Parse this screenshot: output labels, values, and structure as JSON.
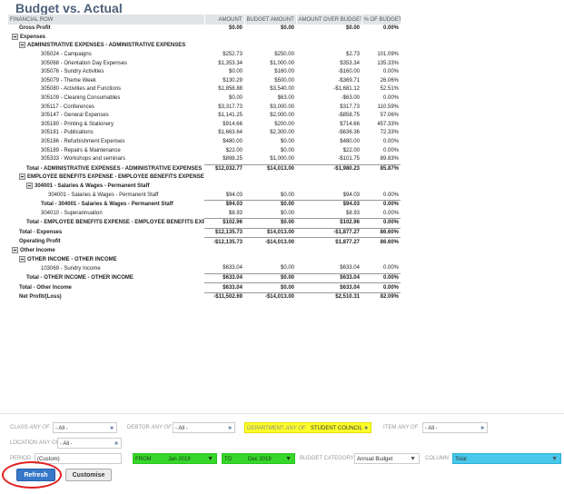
{
  "title": "Budget vs. Actual",
  "columns": [
    "FINANCIAL ROW",
    "AMOUNT",
    "BUDGET AMOUNT",
    "AMOUNT OVER BUDGET",
    "% OF BUDGET"
  ],
  "rows": [
    {
      "label": "Gross Profit",
      "indent": 1,
      "style": "bold",
      "amount": "$0.00",
      "budget": "$0.00",
      "over": "$0.00",
      "pct": "0.00%"
    },
    {
      "label": "Expenses",
      "indent": 0,
      "style": "bold",
      "toggle": true,
      "amount": "",
      "budget": "",
      "over": "",
      "pct": ""
    },
    {
      "label": "ADMINISTRATIVE EXPENSES - ADMINISTRATIVE EXPENSES",
      "indent": 1,
      "style": "bold",
      "toggle": true,
      "amount": "",
      "budget": "",
      "over": "",
      "pct": ""
    },
    {
      "label": "305024 - Campaigns",
      "indent": 4,
      "style": "",
      "amount": "$252.73",
      "budget": "$250.00",
      "over": "$2.73",
      "pct": "101.09%"
    },
    {
      "label": "305068 - Orientation Day Expenses",
      "indent": 4,
      "style": "",
      "amount": "$1,353.34",
      "budget": "$1,000.00",
      "over": "$353.34",
      "pct": "135.33%"
    },
    {
      "label": "305076 - Sundry Activities",
      "indent": 4,
      "style": "",
      "amount": "$0.00",
      "budget": "$160.00",
      "over": "-$160.00",
      "pct": "0.00%"
    },
    {
      "label": "305079 - Theme Week",
      "indent": 4,
      "style": "",
      "amount": "$130.29",
      "budget": "$500.00",
      "over": "-$369.71",
      "pct": "26.06%"
    },
    {
      "label": "305080 - Activities and Functions",
      "indent": 4,
      "style": "",
      "amount": "$1,858.88",
      "budget": "$3,540.00",
      "over": "-$1,681.12",
      "pct": "52.51%"
    },
    {
      "label": "305109 - Cleaning Consumables",
      "indent": 4,
      "style": "",
      "amount": "$0.00",
      "budget": "$63.00",
      "over": "-$63.00",
      "pct": "0.00%"
    },
    {
      "label": "305117 - Conferences",
      "indent": 4,
      "style": "",
      "amount": "$3,317.73",
      "budget": "$3,000.00",
      "over": "$317.73",
      "pct": "110.59%"
    },
    {
      "label": "305147 - General Expenses",
      "indent": 4,
      "style": "",
      "amount": "$1,141.25",
      "budget": "$2,000.00",
      "over": "-$858.75",
      "pct": "57.06%"
    },
    {
      "label": "305180 - Printing & Stationery",
      "indent": 4,
      "style": "",
      "amount": "$914.66",
      "budget": "$200.00",
      "over": "$714.66",
      "pct": "457.33%"
    },
    {
      "label": "305181 - Publications",
      "indent": 4,
      "style": "",
      "amount": "$1,663.64",
      "budget": "$2,300.00",
      "over": "-$636.36",
      "pct": "72.33%"
    },
    {
      "label": "305186 - Refurbishment Expenses",
      "indent": 4,
      "style": "",
      "amount": "$480.00",
      "budget": "$0.00",
      "over": "$480.00",
      "pct": "0.00%"
    },
    {
      "label": "305189 - Repairs & Maintenance",
      "indent": 4,
      "style": "",
      "amount": "$22.00",
      "budget": "$0.00",
      "over": "$22.00",
      "pct": "0.00%"
    },
    {
      "label": "305333 - Workshops and seminars",
      "indent": 4,
      "style": "",
      "amount": "$898.25",
      "budget": "$1,000.00",
      "over": "-$101.75",
      "pct": "89.83%"
    },
    {
      "label": "Total - ADMINISTRATIVE EXPENSES - ADMINISTRATIVE EXPENSES",
      "indent": 2,
      "style": "total",
      "amount": "$12,032.77",
      "budget": "$14,013.00",
      "over": "-$1,980.23",
      "pct": "85.87%"
    },
    {
      "label": "EMPLOYEE BENEFITS EXPENSE - EMPLOYEE BENEFITS EXPENSE",
      "indent": 1,
      "style": "bold",
      "toggle": true,
      "amount": "",
      "budget": "",
      "over": "",
      "pct": ""
    },
    {
      "label": "304001 - Salaries & Wages - Permanent Staff",
      "indent": 2,
      "style": "bold",
      "toggle": true,
      "amount": "",
      "budget": "",
      "over": "",
      "pct": ""
    },
    {
      "label": "304001 - Salaries & Wages - Permanent Staff",
      "indent": 5,
      "style": "",
      "amount": "$94.03",
      "budget": "$0.00",
      "over": "$94.03",
      "pct": "0.00%"
    },
    {
      "label": "Total - 304001 - Salaries & Wages - Permanent Staff",
      "indent": 4,
      "style": "total",
      "amount": "$94.03",
      "budget": "$0.00",
      "over": "$94.03",
      "pct": "0.00%"
    },
    {
      "label": "304010 - Superannuation",
      "indent": 4,
      "style": "",
      "amount": "$8.93",
      "budget": "$0.00",
      "over": "$8.93",
      "pct": "0.00%"
    },
    {
      "label": "Total - EMPLOYEE BENEFITS EXPENSE - EMPLOYEE BENEFITS EXPENSE",
      "indent": 2,
      "style": "total",
      "amount": "$102.96",
      "budget": "$0.00",
      "over": "$102.96",
      "pct": "0.00%"
    },
    {
      "label": "Total - Expenses",
      "indent": 1,
      "style": "total",
      "amount": "$12,135.73",
      "budget": "$14,013.00",
      "over": "-$1,877.27",
      "pct": "86.60%"
    },
    {
      "label": "Operating Profit",
      "indent": 1,
      "style": "total",
      "amount": "-$12,135.73",
      "budget": "-$14,013.00",
      "over": "$1,877.27",
      "pct": "86.60%"
    },
    {
      "label": "Other Income",
      "indent": 0,
      "style": "bold",
      "toggle": true,
      "amount": "",
      "budget": "",
      "over": "",
      "pct": ""
    },
    {
      "label": "OTHER INCOME - OTHER INCOME",
      "indent": 1,
      "style": "bold",
      "toggle": true,
      "amount": "",
      "budget": "",
      "over": "",
      "pct": ""
    },
    {
      "label": "103069 - Sundry Income",
      "indent": 4,
      "style": "",
      "amount": "$633.04",
      "budget": "$0.00",
      "over": "$633.04",
      "pct": "0.00%"
    },
    {
      "label": "Total - OTHER INCOME - OTHER INCOME",
      "indent": 2,
      "style": "total",
      "amount": "$633.04",
      "budget": "$0.00",
      "over": "$633.04",
      "pct": "0.00%"
    },
    {
      "label": "Total - Other Income",
      "indent": 1,
      "style": "total",
      "amount": "$633.04",
      "budget": "$0.00",
      "over": "$633.04",
      "pct": "0.00%"
    },
    {
      "label": "Net Profit/(Loss)",
      "indent": 1,
      "style": "total",
      "amount": "-$11,502.69",
      "budget": "-$14,013.00",
      "over": "$2,510.31",
      "pct": "82.09%"
    }
  ],
  "filters": {
    "class_label": "CLASS",
    "class_any": "ANY OF",
    "class_value": "- All -",
    "debtor_label": "DEBTOR",
    "debtor_any": "ANY OF",
    "debtor_value": "- All -",
    "department_label": "DEPARTMENT",
    "department_any": "ANY OF",
    "department_value": "STUDENT COUNCIL",
    "item_label": "ITEM",
    "item_any": "ANY OF",
    "item_value": "- All -",
    "location_label": "LOCATION",
    "location_any": "ANY OF",
    "location_value": "- All -",
    "period_label": "PERIOD",
    "period_value": "(Custom)",
    "from_label": "FROM",
    "from_value": "Jan 2019",
    "to_label": "TO",
    "to_value": "Dec 2019",
    "budget_category_label": "BUDGET CATEGORY",
    "budget_category_value": "Annual Budget",
    "column_label": "COLUMN",
    "column_value": "Total"
  },
  "buttons": {
    "refresh": "Refresh",
    "customise": "Customise"
  },
  "colors": {
    "title": "#4d5f79",
    "header_bg": "#e2e4e7",
    "refresh_bg": "#3778c9",
    "highlight_circle": "#e2201f",
    "period_green": "#37d62b",
    "department_yellow": "#ffff2a",
    "column_blue": "#48c8ea"
  }
}
